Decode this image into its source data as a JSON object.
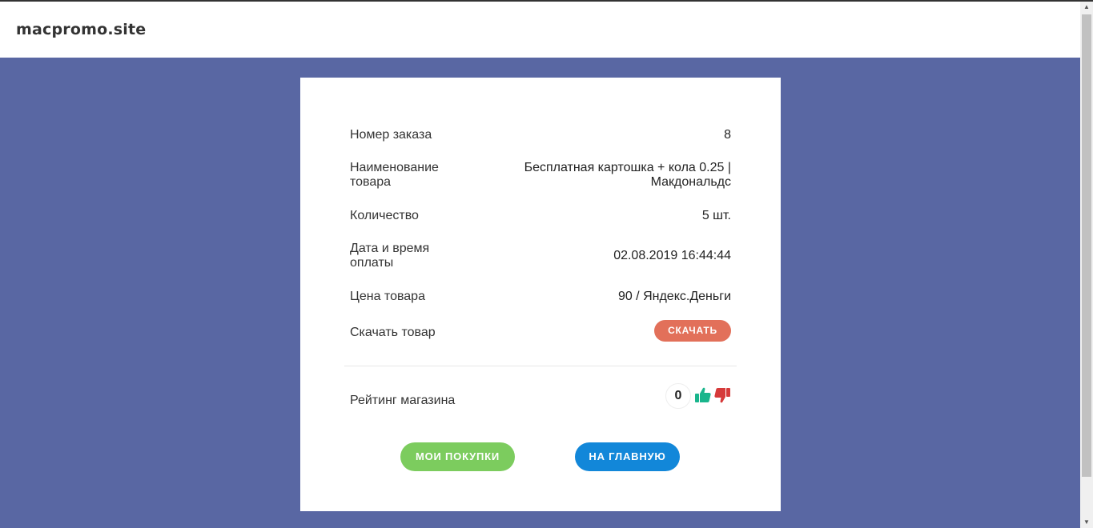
{
  "header": {
    "brand": "macpromo.site"
  },
  "order": {
    "rows": [
      {
        "label": "Номер заказа",
        "value": "8"
      },
      {
        "label": "Наименование товара",
        "value": "Бесплатная картошка + кола 0.25 | Макдональдс"
      },
      {
        "label": "Количество",
        "value": "5 шт."
      },
      {
        "label": "Дата и время оплаты",
        "value": "02.08.2019 16:44:44"
      },
      {
        "label": "Цена товара",
        "value": "90 / Яндекс.Деньги"
      }
    ],
    "download": {
      "label": "Скачать товар",
      "button": "СКАЧАТЬ"
    }
  },
  "rating": {
    "label": "Рейтинг магазина",
    "count": "0",
    "up_icon": "thumbs-up-icon",
    "down_icon": "thumbs-down-icon"
  },
  "actions": {
    "purchases": "МОИ ПОКУПКИ",
    "home": "НА ГЛАВНУЮ"
  },
  "colors": {
    "background": "#5967a3",
    "download_button": "#e2705a",
    "purchases_button": "#7ccc5e",
    "home_button": "#1287d9",
    "thumbs_up": "#19b58c",
    "thumbs_down": "#d63a3a"
  }
}
